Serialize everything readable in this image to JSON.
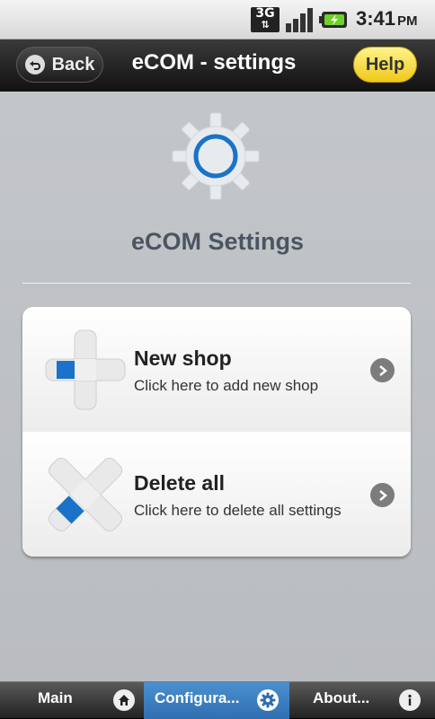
{
  "status_bar": {
    "network": "3G",
    "time": "3:41",
    "ampm": "PM"
  },
  "header": {
    "back_label": "Back",
    "title": "eCOM - settings",
    "help_label": "Help"
  },
  "main": {
    "heading": "eCOM Settings",
    "items": [
      {
        "title": "New shop",
        "subtitle": "Click here to add new shop",
        "icon": "plus-icon"
      },
      {
        "title": "Delete all",
        "subtitle": "Click here to delete all settings",
        "icon": "delete-x-icon"
      }
    ]
  },
  "tabs": [
    {
      "label": "Main",
      "icon": "home-icon",
      "selected": false
    },
    {
      "label": "Configura...",
      "icon": "gear-icon",
      "selected": true
    },
    {
      "label": "About...",
      "icon": "info-icon",
      "selected": false
    }
  ],
  "colors": {
    "accent_blue": "#1a73c8",
    "tab_selected": "#3f82c4",
    "help_yellow": "#f6d53a"
  }
}
